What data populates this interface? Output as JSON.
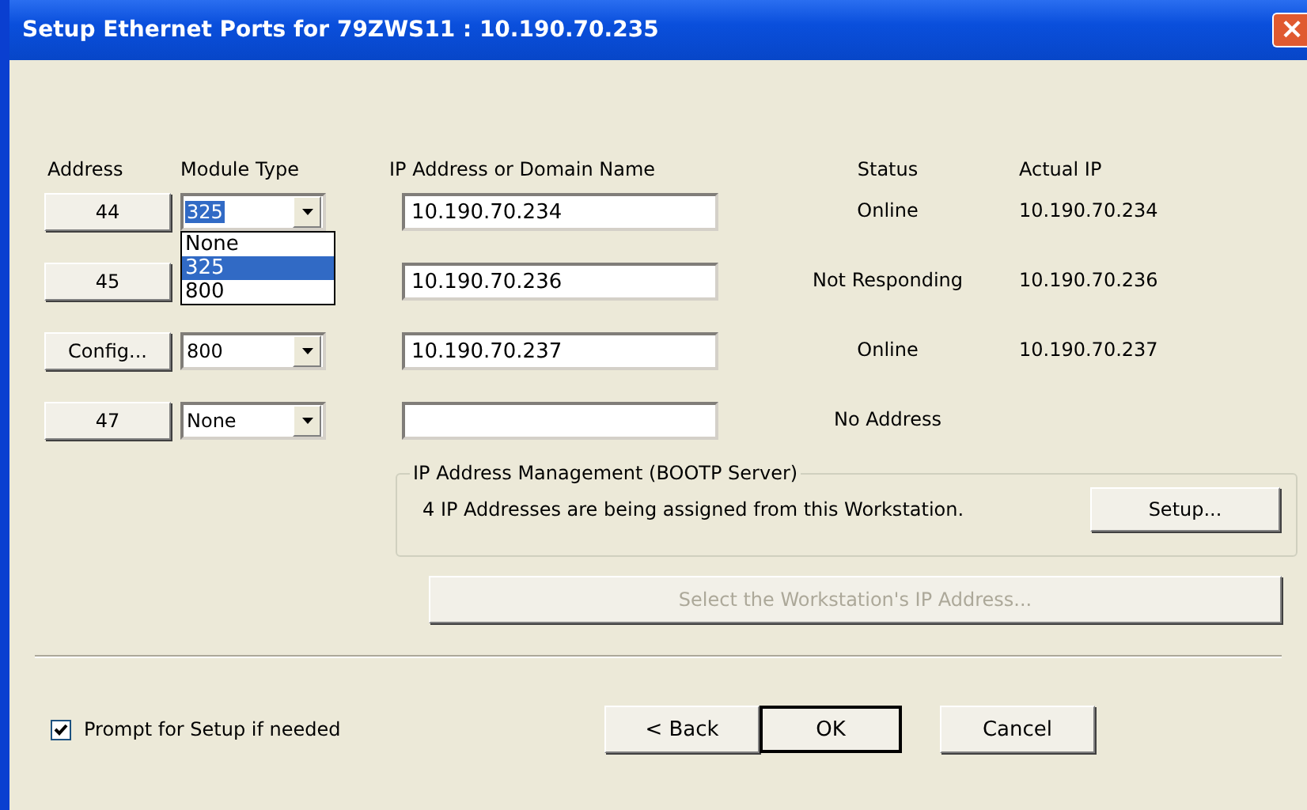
{
  "window": {
    "title": "Setup Ethernet Ports for 79ZWS11 : 10.190.70.235",
    "close": "×"
  },
  "headers": [
    "Address",
    "Module Type",
    "IP Address or Domain Name",
    "Status",
    "Actual IP"
  ],
  "ports": [
    {
      "address": "44",
      "module_type": "325",
      "focused": true,
      "ip": "10.190.70.234",
      "status": "Online",
      "actual_ip": "10.190.70.234"
    },
    {
      "address": "45",
      "ip": "10.190.70.236",
      "status": "Not Responding",
      "actual_ip": "10.190.70.236"
    },
    {
      "address": "Config...",
      "module_type": "800",
      "focused": false,
      "ip": "10.190.70.237",
      "status": "Online",
      "actual_ip": "10.190.70.237"
    },
    {
      "address": "47",
      "module_type": "None",
      "focused": false,
      "status": "No Address"
    }
  ],
  "dropdown": {
    "options": [
      {
        "label": "None",
        "selected": false
      },
      {
        "label": "325",
        "selected": true
      },
      {
        "label": "800",
        "selected": false
      }
    ]
  },
  "bootp": {
    "title": "IP Address Management (BOOTP Server)",
    "message": "4 IP Addresses are being assigned from this Workstation.",
    "button": "Setup..."
  },
  "select_button": {
    "label": "Select the Workstation's IP Address...",
    "disabled": true
  },
  "prompt": {
    "label": "Prompt for Setup if needed",
    "checked": true
  },
  "buttons": [
    {
      "label": "< Back",
      "default": false
    },
    {
      "label": "OK",
      "default": true
    },
    {
      "label": "Cancel",
      "default": false
    }
  ]
}
